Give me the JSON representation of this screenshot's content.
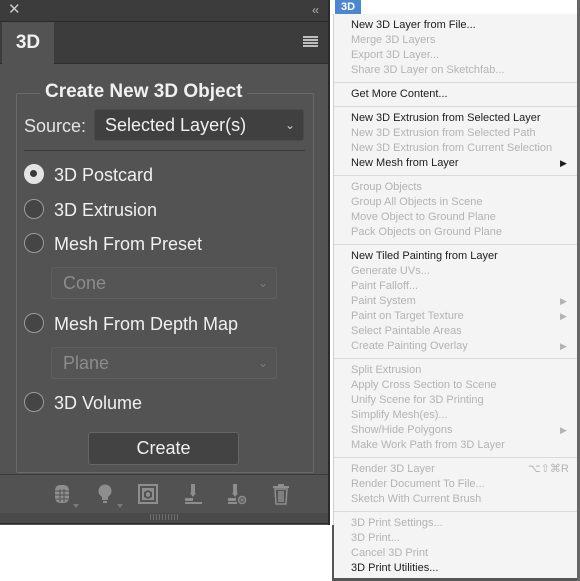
{
  "panel": {
    "close_glyph": "✕",
    "collapse_glyph": "‹‹",
    "tab_label": "3D",
    "group_title": "Create New 3D Object",
    "source_label": "Source:",
    "source_value": "Selected Layer(s)",
    "options": [
      {
        "label": "3D Postcard",
        "checked": true
      },
      {
        "label": "3D Extrusion",
        "checked": false
      },
      {
        "label": "Mesh From Preset",
        "checked": false
      },
      {
        "label": "Mesh From Depth Map",
        "checked": false
      },
      {
        "label": "3D Volume",
        "checked": false
      }
    ],
    "preset_select": "Cone",
    "depth_map_select": "Plane",
    "create_button": "Create",
    "toolbar_icons": [
      "scene-filter-icon",
      "light-filter-icon",
      "new-3d-object-icon",
      "drop-to-ground-icon",
      "remove-from-ground-icon",
      "delete-icon"
    ]
  },
  "menu": {
    "title": "3D",
    "groups": [
      [
        {
          "label": "New 3D Layer from File...",
          "enabled": true
        },
        {
          "label": "Merge 3D Layers",
          "enabled": false
        },
        {
          "label": "Export 3D Layer...",
          "enabled": false
        },
        {
          "label": "Share 3D Layer on Sketchfab...",
          "enabled": false
        }
      ],
      [
        {
          "label": "Get More Content...",
          "enabled": true
        }
      ],
      [
        {
          "label": "New 3D Extrusion from Selected Layer",
          "enabled": true
        },
        {
          "label": "New 3D Extrusion from Selected Path",
          "enabled": false
        },
        {
          "label": "New 3D Extrusion from Current Selection",
          "enabled": false
        },
        {
          "label": "New Mesh from Layer",
          "enabled": true,
          "submenu": true
        }
      ],
      [
        {
          "label": "Group Objects",
          "enabled": false
        },
        {
          "label": "Group All Objects in Scene",
          "enabled": false
        },
        {
          "label": "Move Object to Ground Plane",
          "enabled": false
        },
        {
          "label": "Pack Objects on Ground Plane",
          "enabled": false
        }
      ],
      [
        {
          "label": "New Tiled Painting from Layer",
          "enabled": true
        },
        {
          "label": "Generate UVs...",
          "enabled": false
        },
        {
          "label": "Paint Falloff...",
          "enabled": false
        },
        {
          "label": "Paint System",
          "enabled": false,
          "submenu": true
        },
        {
          "label": "Paint on Target Texture",
          "enabled": false,
          "submenu": true
        },
        {
          "label": "Select Paintable Areas",
          "enabled": false
        },
        {
          "label": "Create Painting Overlay",
          "enabled": false,
          "submenu": true
        }
      ],
      [
        {
          "label": "Split Extrusion",
          "enabled": false
        },
        {
          "label": "Apply Cross Section to Scene",
          "enabled": false
        },
        {
          "label": "Unify Scene for 3D Printing",
          "enabled": false
        },
        {
          "label": "Simplify Mesh(es)...",
          "enabled": false
        },
        {
          "label": "Show/Hide Polygons",
          "enabled": false,
          "submenu": true
        },
        {
          "label": "Make Work Path from 3D Layer",
          "enabled": false
        }
      ],
      [
        {
          "label": "Render 3D Layer",
          "enabled": false,
          "shortcut": "⌥⇧⌘R"
        },
        {
          "label": "Render Document To File...",
          "enabled": false
        },
        {
          "label": "Sketch With Current Brush",
          "enabled": false
        }
      ],
      [
        {
          "label": "3D Print Settings...",
          "enabled": false
        },
        {
          "label": "3D Print...",
          "enabled": false
        },
        {
          "label": "Cancel 3D Print",
          "enabled": false
        },
        {
          "label": "3D Print Utilities...",
          "enabled": true
        }
      ]
    ]
  }
}
